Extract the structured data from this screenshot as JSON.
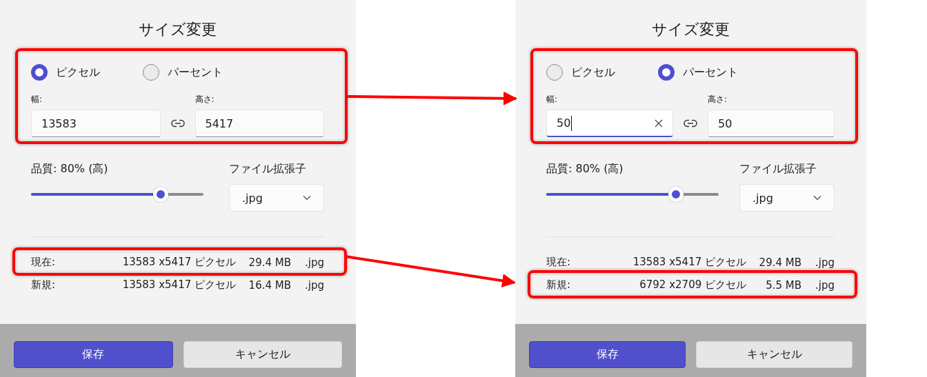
{
  "panels": [
    {
      "title": "サイズ変更",
      "size_highlighted": true,
      "units": [
        {
          "label": "ピクセル",
          "selected": true
        },
        {
          "label": "パーセント",
          "selected": false
        }
      ],
      "width": {
        "label": "幅:",
        "value": "13583",
        "focused": false
      },
      "height": {
        "label": "高さ:",
        "value": "5417",
        "focused": false
      },
      "quality": {
        "label": "品質: 80% (高)",
        "level": 0.75
      },
      "extension": {
        "label": "ファイル拡張子",
        "value": ".jpg"
      },
      "info": [
        {
          "label": "現在:",
          "dimensions": "13583 x5417 ピクセル",
          "file_size": "29.4 MB",
          "ext": ".jpg",
          "highlighted": true
        },
        {
          "label": "新規:",
          "dimensions": "13583 x5417 ピクセル",
          "file_size": "16.4 MB",
          "ext": ".jpg",
          "highlighted": false
        }
      ],
      "buttons": [
        {
          "label": "保存",
          "kind": "primary"
        },
        {
          "label": "キャンセル",
          "kind": "secondary"
        }
      ]
    },
    {
      "title": "サイズ変更",
      "size_highlighted": true,
      "units": [
        {
          "label": "ピクセル",
          "selected": false
        },
        {
          "label": "パーセント",
          "selected": true
        }
      ],
      "width": {
        "label": "幅:",
        "value": "50",
        "focused": true
      },
      "height": {
        "label": "高さ:",
        "value": "50",
        "focused": false
      },
      "quality": {
        "label": "品質: 80% (高)",
        "level": 0.75
      },
      "extension": {
        "label": "ファイル拡張子",
        "value": ".jpg"
      },
      "info": [
        {
          "label": "現在:",
          "dimensions": "13583 x5417 ピクセル",
          "file_size": "29.4 MB",
          "ext": ".jpg",
          "highlighted": false
        },
        {
          "label": "新規:",
          "dimensions": "6792 x2709 ピクセル",
          "file_size": "5.5 MB",
          "ext": ".jpg",
          "highlighted": true
        }
      ],
      "buttons": [
        {
          "label": "保存",
          "kind": "primary"
        },
        {
          "label": "キャンセル",
          "kind": "secondary"
        }
      ]
    }
  ]
}
